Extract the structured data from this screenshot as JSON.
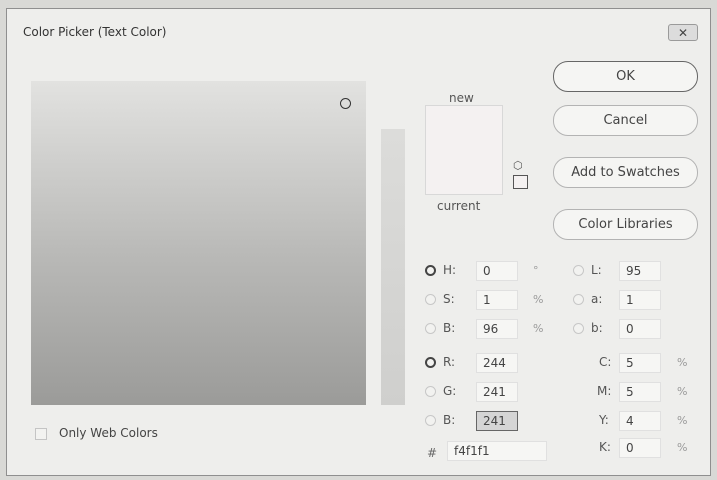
{
  "window": {
    "title": "Color Picker (Text Color)",
    "close_icon": "close-x-icon"
  },
  "preview": {
    "new_label": "new",
    "current_label": "current",
    "new_color": "#f4f1f1",
    "current_color": "#f4f1f1"
  },
  "buttons": {
    "ok": "OK",
    "cancel": "Cancel",
    "add_to_swatches": "Add to Swatches",
    "color_libraries": "Color Libraries"
  },
  "hsb": {
    "h": {
      "label": "H:",
      "value": "0",
      "unit": "°"
    },
    "s": {
      "label": "S:",
      "value": "1",
      "unit": "%"
    },
    "b": {
      "label": "B:",
      "value": "96",
      "unit": "%"
    }
  },
  "rgb": {
    "r": {
      "label": "R:",
      "value": "244"
    },
    "g": {
      "label": "G:",
      "value": "241"
    },
    "b": {
      "label": "B:",
      "value": "241"
    }
  },
  "lab": {
    "l": {
      "label": "L:",
      "value": "95"
    },
    "a": {
      "label": "a:",
      "value": "1"
    },
    "b": {
      "label": "b:",
      "value": "0"
    }
  },
  "cmyk": {
    "c": {
      "label": "C:",
      "value": "5",
      "unit": "%"
    },
    "m": {
      "label": "M:",
      "value": "5",
      "unit": "%"
    },
    "y": {
      "label": "Y:",
      "value": "4",
      "unit": "%"
    },
    "k": {
      "label": "K:",
      "value": "0",
      "unit": "%"
    }
  },
  "hex": {
    "symbol": "#",
    "value": "f4f1f1"
  },
  "options": {
    "only_web_colors": "Only Web Colors"
  }
}
